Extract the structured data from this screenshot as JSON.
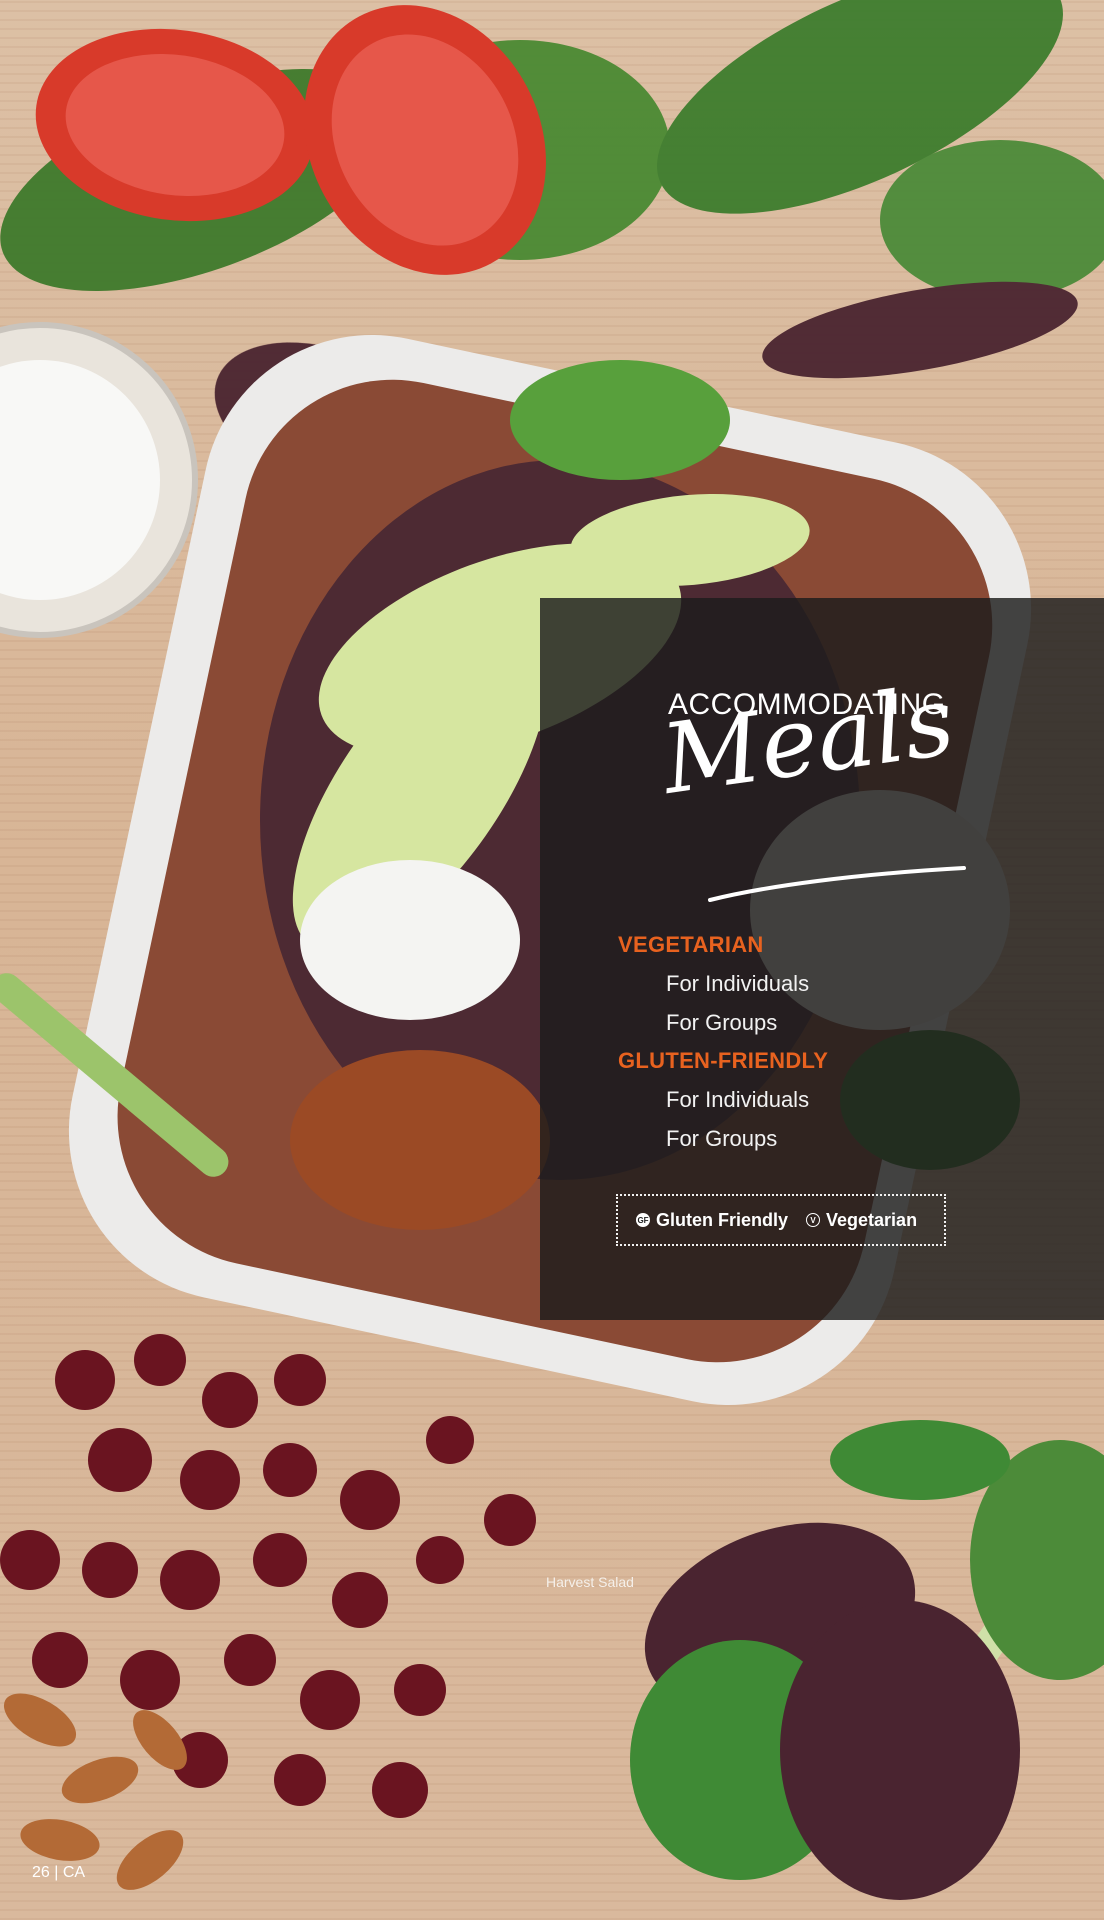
{
  "heading": {
    "line1": "ACCOMMODATING",
    "script": "Meals"
  },
  "menu": [
    {
      "category": "VEGETARIAN",
      "items": [
        "For Individuals",
        "For Groups"
      ]
    },
    {
      "category": "GLUTEN-FRIENDLY",
      "items": [
        "For Individuals",
        "For Groups"
      ]
    }
  ],
  "legend": {
    "gf_badge": "GF",
    "gf_label": "Gluten Friendly",
    "v_badge": "V",
    "v_label": "Vegetarian"
  },
  "photo_caption": "Harvest Salad",
  "footer": {
    "page": "26",
    "separator": "|",
    "region": "CA"
  },
  "colors": {
    "accent": "#e8621f",
    "panel": "#1c1c1c"
  }
}
